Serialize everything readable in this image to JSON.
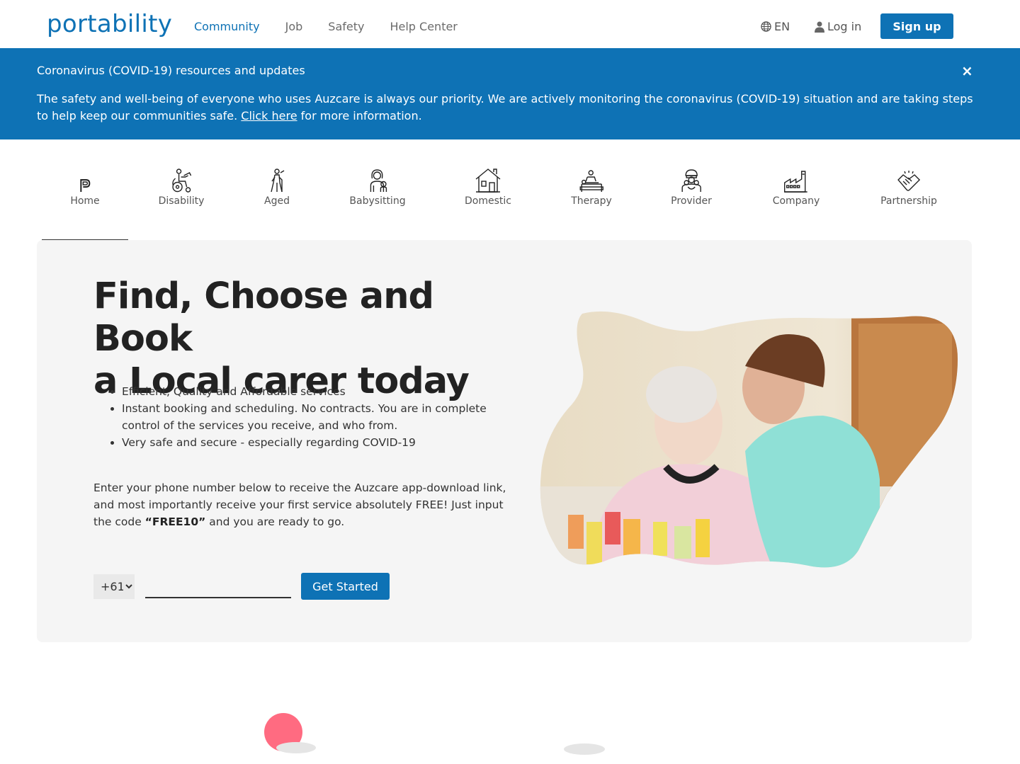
{
  "header": {
    "logo": "portability",
    "nav": [
      "Community",
      "Job",
      "Safety",
      "Help Center"
    ],
    "active_nav": "Community",
    "lang": "EN",
    "login": "Log in",
    "signup": "Sign up"
  },
  "banner": {
    "title": "Coronavirus (COVID-19) resources and updates",
    "text_before": "The safety and well-being of everyone who uses Auzcare is always our priority. We are actively monitoring the coronavirus (COVID-19) situation and are taking steps to help keep our communities safe. ",
    "link": "Click here",
    "text_after": " for more information.",
    "close": "×"
  },
  "categories": [
    {
      "label": "Home",
      "icon": "home-p-icon"
    },
    {
      "label": "Disability",
      "icon": "wheelchair-icon"
    },
    {
      "label": "Aged",
      "icon": "elderly-icon"
    },
    {
      "label": "Babysitting",
      "icon": "babysitter-icon"
    },
    {
      "label": "Domestic",
      "icon": "house-icon"
    },
    {
      "label": "Therapy",
      "icon": "massage-icon"
    },
    {
      "label": "Provider",
      "icon": "provider-icon"
    },
    {
      "label": "Company",
      "icon": "factory-icon"
    },
    {
      "label": "Partnership",
      "icon": "handshake-icon"
    }
  ],
  "hero": {
    "title_line1": "Find, Choose and Book",
    "title_line2": "a Local carer today",
    "bullets": [
      "Efficient, Quality and Affordable services",
      "Instant booking and scheduling. No contracts. You are in complete control of the services you receive, and who from.",
      "Very safe and secure - especially regarding COVID-19"
    ],
    "intro_before": "Enter your phone number below to receive the Auzcare app-download link, and most importantly receive your first service absolutely FREE! Just input the code ",
    "intro_code": "“FREE10”",
    "intro_after": " and you are ready to go.",
    "country_code": "+61",
    "phone_value": "",
    "cta": "Get Started"
  },
  "colors": {
    "brand": "#0e72b5",
    "hero_bg": "#f5f5f5",
    "accent_pink": "#ff6b81"
  }
}
